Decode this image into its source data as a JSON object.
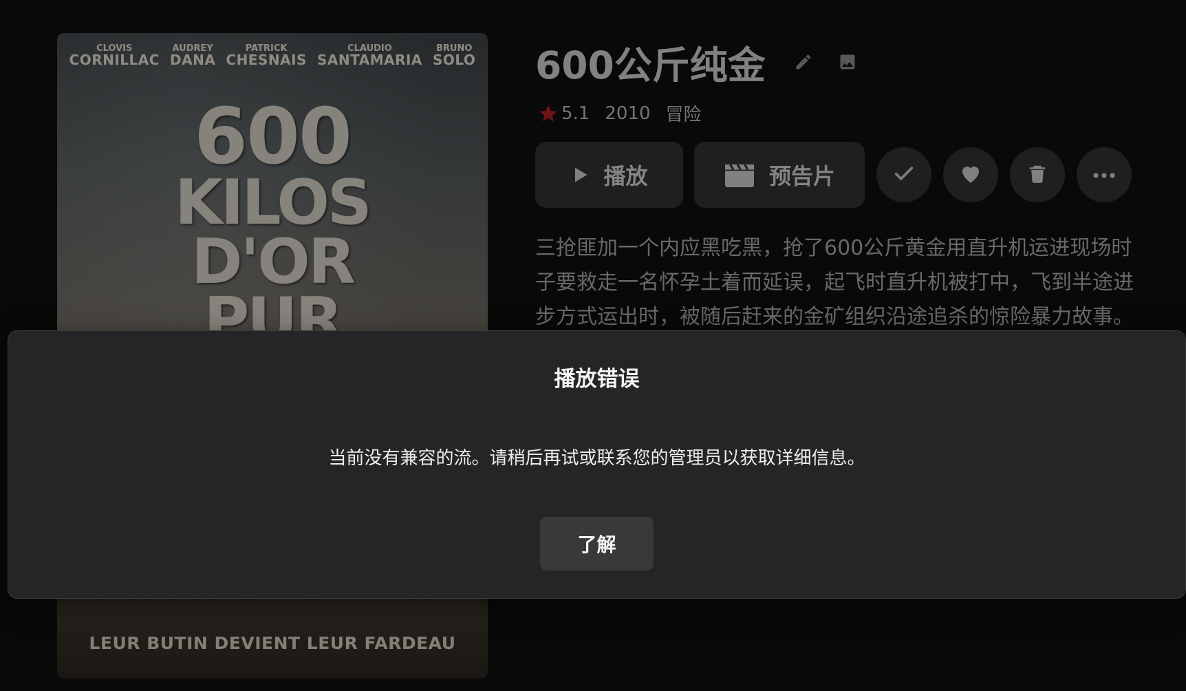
{
  "poster": {
    "cast": [
      {
        "first": "CLOVIS",
        "last": "CORNILLAC"
      },
      {
        "first": "AUDREY",
        "last": "DANA"
      },
      {
        "first": "PATRICK",
        "last": "CHESNAIS"
      },
      {
        "first": "CLAUDIO",
        "last": "SANTAMARIA"
      },
      {
        "first": "BRUNO",
        "last": "SOLO"
      }
    ],
    "title_lines": [
      "600",
      "KILOS",
      "D'OR",
      "PUR"
    ],
    "tagline": "LEUR BUTIN DEVIENT LEUR FARDEAU"
  },
  "movie": {
    "title": "600公斤纯金",
    "rating": "5.1",
    "year": "2010",
    "genre": "冒险",
    "overview_lines": [
      "三抢匪加一个内应黑吃黑，抢了600公斤黄金用直升机运进现场时",
      "子要救走一名怀孕土着而延误，起飞时直升机被打中，飞到半途进",
      "步方式运出时，被随后赶来的金矿组织沿途追杀的惊险暴力故事。"
    ]
  },
  "actions": {
    "play_label": "播放",
    "trailer_label": "预告片"
  },
  "icons": {
    "edit": "pencil-icon",
    "image": "image-icon",
    "star": "star-icon",
    "play": "play-icon",
    "trailer": "clapperboard-icon",
    "watched": "checkmark-icon",
    "favorite": "heart-icon",
    "delete": "trash-icon",
    "more": "more-dots-icon"
  },
  "colors": {
    "star": "#e0322c",
    "modal_bg": "#252527",
    "button_bg": "#39393b"
  },
  "dialog": {
    "title": "播放错误",
    "message": "当前没有兼容的流。请稍后再试或联系您的管理员以获取详细信息。",
    "button_label": "了解"
  }
}
